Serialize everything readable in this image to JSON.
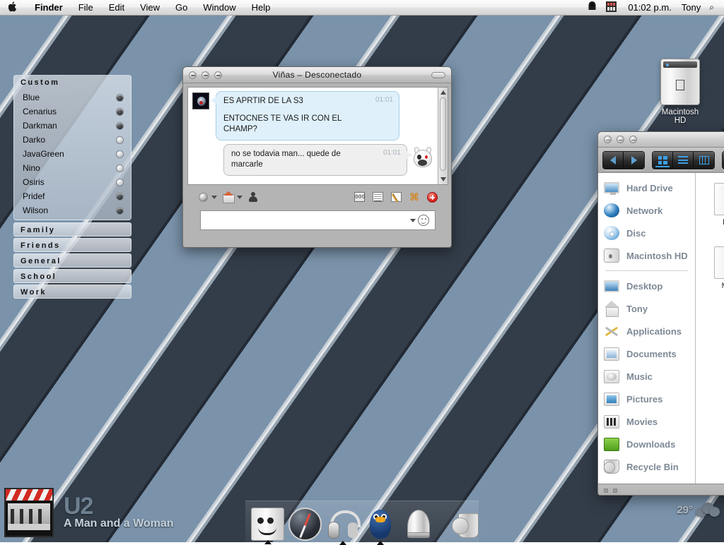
{
  "menubar": {
    "apple_glyph": "⌘",
    "apple_icon_name": "apple-logo-icon",
    "items": [
      "Finder",
      "File",
      "Edit",
      "View",
      "Go",
      "Window",
      "Help"
    ],
    "right": {
      "icons": [
        "hooded-figure-menu-icon",
        "grid-app-menu-icon"
      ],
      "time": "01:02 p.m.",
      "user": "Tony",
      "search_glyph": "⌕"
    }
  },
  "buddy_list": {
    "open_group": {
      "title": "Custom",
      "contacts": [
        {
          "name": "Blue",
          "status": "online"
        },
        {
          "name": "Cenarius",
          "status": "online"
        },
        {
          "name": "Darkman",
          "status": "online"
        },
        {
          "name": "Darko",
          "status": "offline"
        },
        {
          "name": "JavaGreen",
          "status": "offline"
        },
        {
          "name": "Nino",
          "status": "offline"
        },
        {
          "name": "Osiris",
          "status": "offline"
        },
        {
          "name": "Pridef",
          "status": "online"
        },
        {
          "name": "Wilson",
          "status": "online"
        }
      ]
    },
    "closed_groups": [
      "Family",
      "Friends",
      "General",
      "School",
      "Work"
    ]
  },
  "chat": {
    "title": "Viñas – Desconectado",
    "messages": [
      {
        "direction": "incoming",
        "time": "01:01",
        "lines": [
          "ES APRTIR DE LA S3",
          "ENTOCNES TE VAS IR CON EL CHAMP?"
        ]
      },
      {
        "direction": "outgoing",
        "time": "01:01",
        "lines": [
          "no se todavia man... quede de marcarle"
        ]
      }
    ],
    "toolbar_left_icons": [
      "status-dot-icon",
      "chevron-down-icon",
      "house-icon",
      "chevron-down-icon",
      "person-icon"
    ],
    "toolbar_right_icons": [
      "blocks-icon",
      "document-icon",
      "notepad-pencil-icon",
      "command-key-icon",
      "add-red-button"
    ],
    "input_placeholder": "",
    "input_value": "",
    "emoticon_icon": "smiley-icon"
  },
  "finder": {
    "nav_back_icon": "arrow-left-icon",
    "nav_forward_icon": "arrow-right-icon",
    "view_icons": [
      "icon-view-icon",
      "list-view-icon",
      "column-view-icon"
    ],
    "action_icon": "action-menu-icon",
    "sidebar": {
      "devices": [
        {
          "label": "Hard Drive",
          "icon": "monitor-icon"
        },
        {
          "label": "Network",
          "icon": "globe-icon"
        },
        {
          "label": "Disc",
          "icon": "disc-icon"
        },
        {
          "label": "Macintosh HD",
          "icon": "harddrive-icon"
        }
      ],
      "places": [
        {
          "label": "Desktop",
          "icon": "desktop-icon"
        },
        {
          "label": "Tony",
          "icon": "home-icon"
        },
        {
          "label": "Applications",
          "icon": "applications-icon"
        },
        {
          "label": "Documents",
          "icon": "documents-folder-icon"
        },
        {
          "label": "Music",
          "icon": "music-folder-icon"
        },
        {
          "label": "Pictures",
          "icon": "pictures-folder-icon"
        },
        {
          "label": "Movies",
          "icon": "movies-folder-icon"
        },
        {
          "label": "Downloads",
          "icon": "downloads-folder-icon"
        },
        {
          "label": "Recycle Bin",
          "icon": "recycle-bin-icon"
        }
      ]
    },
    "files": [
      {
        "label": "Do"
      },
      {
        "label": "Mis"
      }
    ]
  },
  "desktop_icons": [
    {
      "label": "Macintosh HD",
      "icon": "macintosh-hd-icon"
    }
  ],
  "music_widget": {
    "artist": "U2",
    "track": "A Man and a Woman",
    "album_art": "u2-album-cover"
  },
  "dock": {
    "items": [
      {
        "name": "finder",
        "icon": "finder-icon",
        "running": true
      },
      {
        "name": "safari",
        "icon": "compass-icon",
        "running": false
      },
      {
        "name": "itunes",
        "icon": "headphones-icon",
        "running": true
      },
      {
        "name": "messenger",
        "icon": "penguin-icon",
        "running": true
      },
      {
        "name": "mail",
        "icon": "cone-icon",
        "running": false
      },
      {
        "name": "trash",
        "icon": "trash-icon",
        "running": false
      }
    ]
  },
  "weather_widget": {
    "temperature": "29°",
    "condition_icon": "cloudy-icon"
  },
  "colors": {
    "wallpaper_light": "#7e98b2",
    "wallpaper_dark": "#313c49",
    "accent_blue": "#3aa0e8",
    "bubble_incoming": "#dff0fb",
    "bubble_outgoing": "#efefef",
    "sidebar_label": "#7d8996",
    "red_button": "#d4201c"
  }
}
